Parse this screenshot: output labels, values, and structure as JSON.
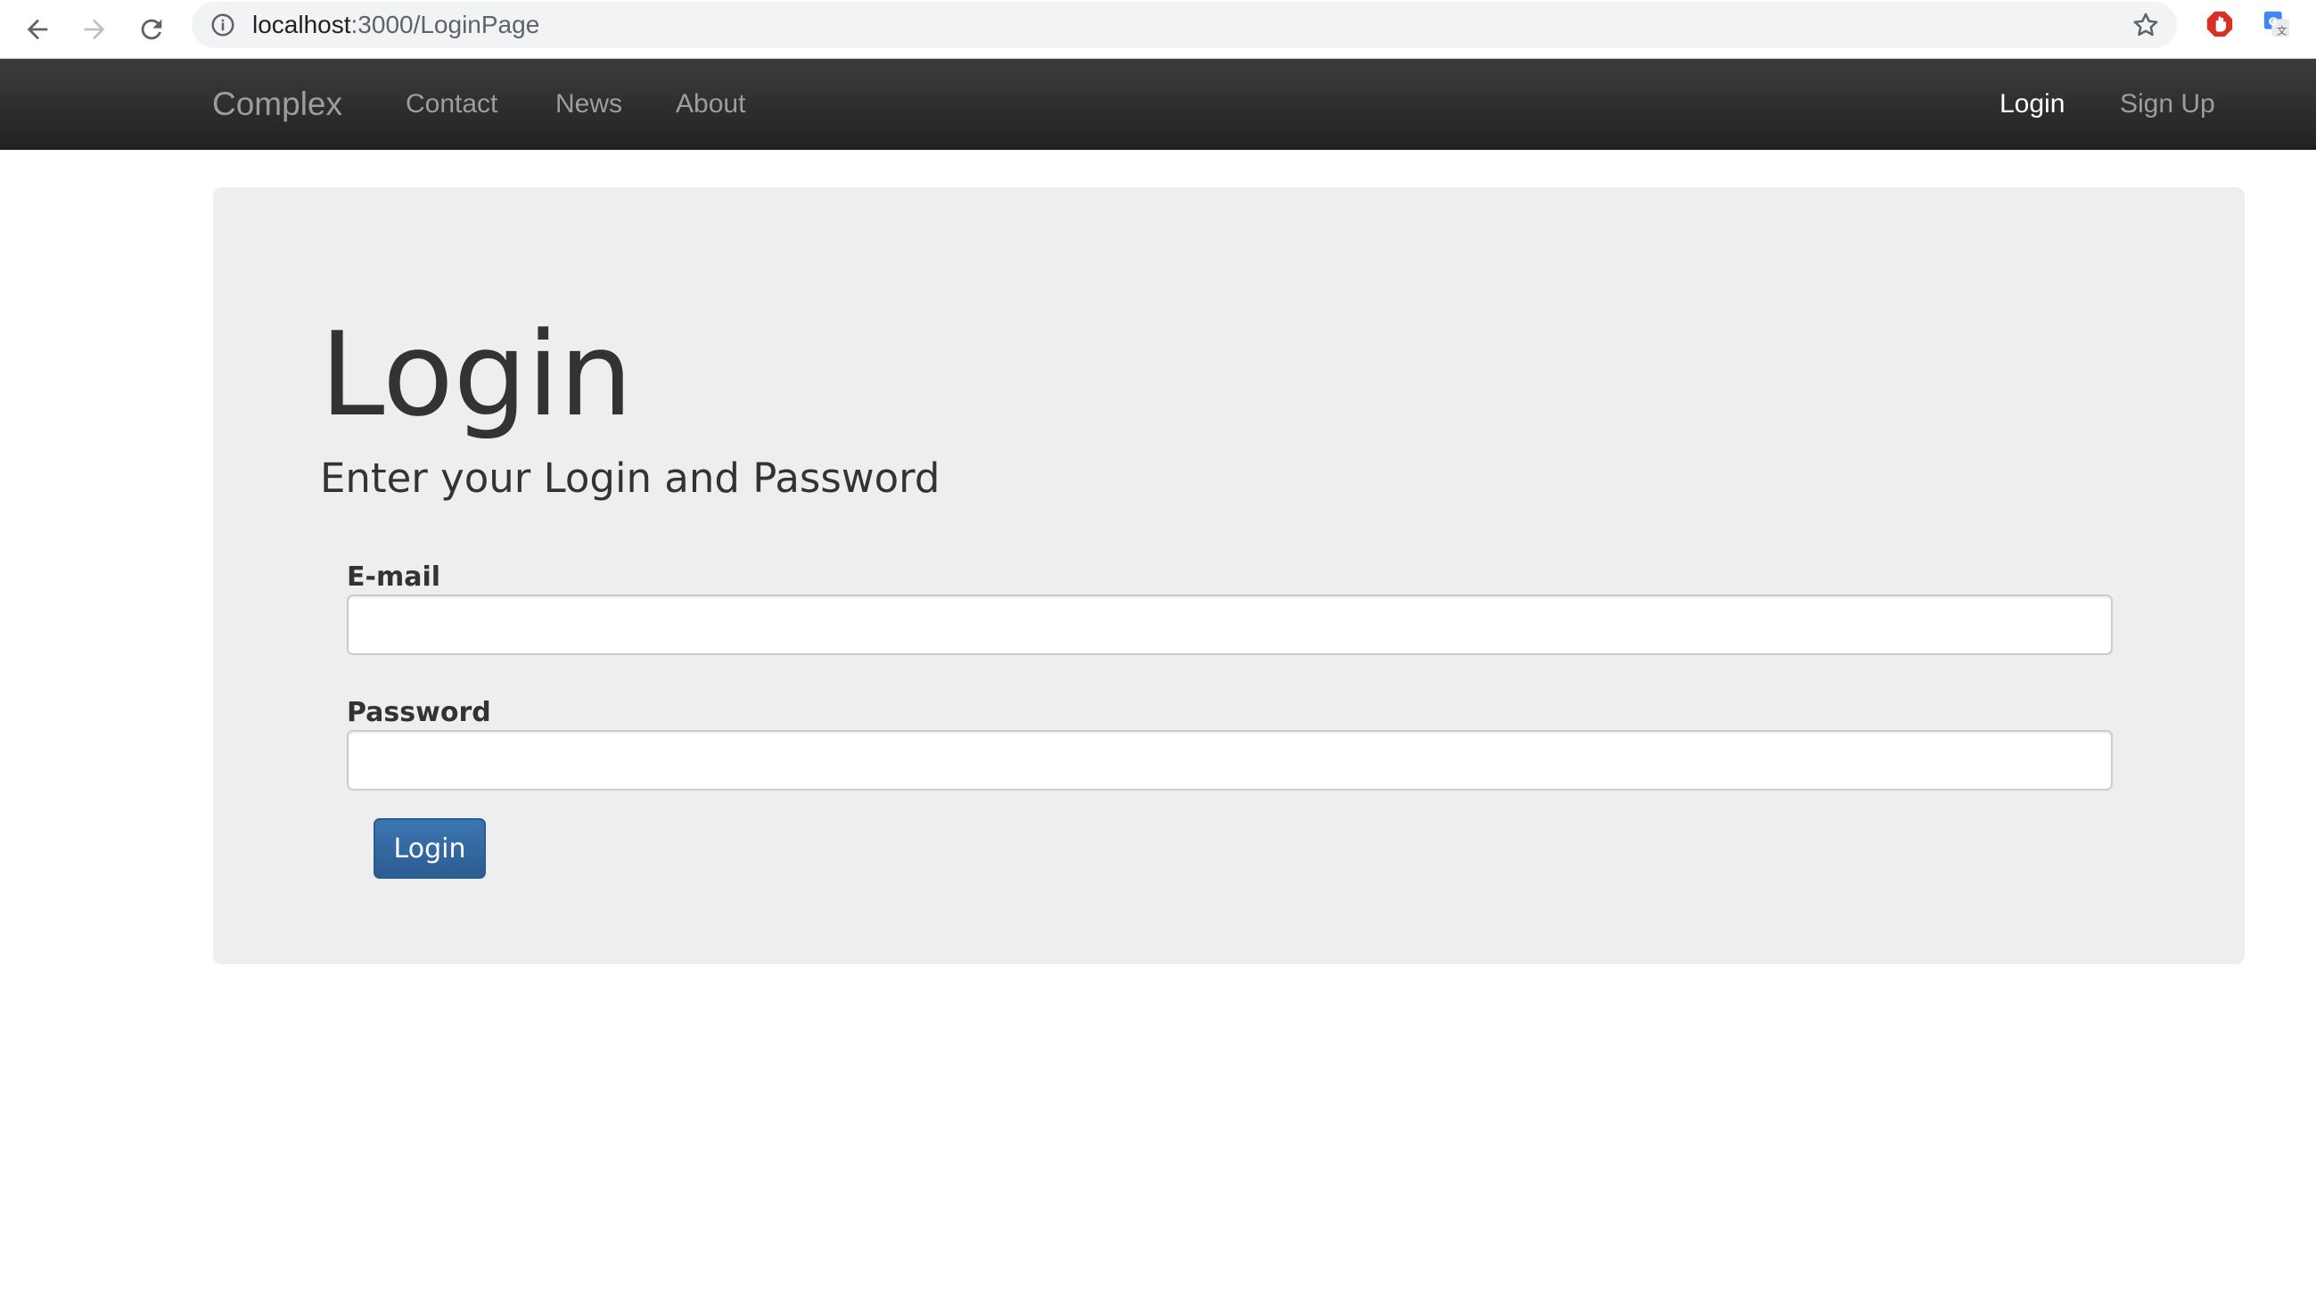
{
  "browser": {
    "url_host": "localhost",
    "url_path": ":3000/LoginPage",
    "icons": [
      "back-icon",
      "forward-icon",
      "reload-icon",
      "info-icon",
      "star-icon",
      "adblock-extension-icon",
      "translate-extension-icon"
    ]
  },
  "navbar": {
    "brand": "Complex",
    "links": [
      {
        "label": "Contact"
      },
      {
        "label": "News"
      },
      {
        "label": "About"
      }
    ],
    "right_links": [
      {
        "label": "Login",
        "active": true
      },
      {
        "label": "Sign Up",
        "active": false
      }
    ]
  },
  "jumbotron": {
    "title": "Login",
    "subtitle": "Enter your Login and Password"
  },
  "form": {
    "email_label": "E-mail",
    "email_value": "",
    "password_label": "Password",
    "password_value": "",
    "submit_label": "Login"
  },
  "colors": {
    "navbar_bg": "#222222",
    "jumbotron_bg": "#eeeeee",
    "primary_button": "#337ab7"
  }
}
